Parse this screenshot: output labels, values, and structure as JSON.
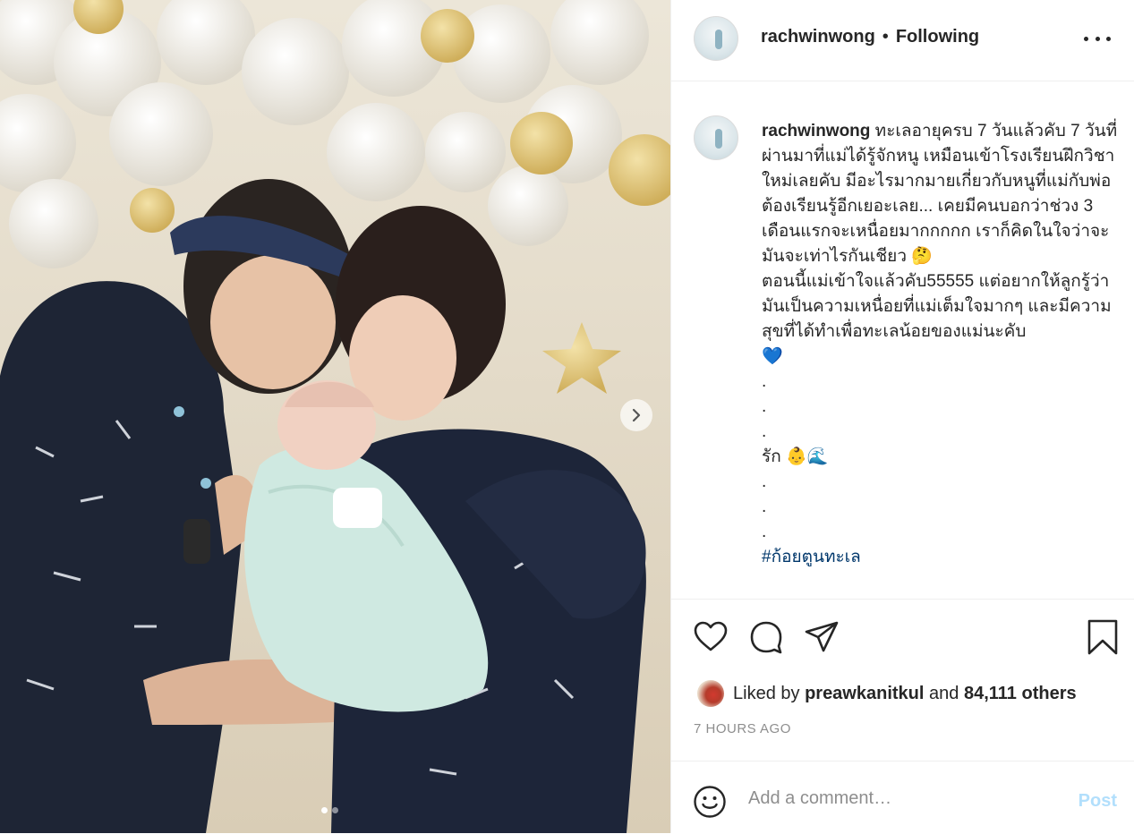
{
  "post": {
    "username": "rachwinwong",
    "separator": "•",
    "follow_status": "Following",
    "more_icon": "more-horizontal-icon"
  },
  "caption": {
    "username": "rachwinwong",
    "text": " ทะเลอายุครบ 7 วันแล้วคับ 7 วันที่ผ่านมาที่แม่ได้รู้จักหนู เหมือนเข้าโรงเรียนฝึกวิชาใหม่เลยคับ มีอะไรมากมายเกี่ยวกับหนูที่แม่กับพ่อต้องเรียนรู้อีกเยอะเลย... เคยมีคนบอกว่าช่วง 3 เดือนแรกจะเหนื่อยมากกกกก เราก็คิดในใจว่าจะมันจะเท่าไรกันเชียว 🤔\nตอนนี้แม่เข้าใจแล้วคับ55555 แต่อยากให้ลูกรู้ว่ามันเป็นความเหนื่อยที่แม่เต็มใจมากๆ และมีความสุขที่ได้ทำเพื่อทะเลน้อยของแม่นะคับ\n💙\n.\n.\n.\nรัก 👶🌊\n.\n.\n.\n",
    "hashtag": "#ก้อยตูนทะเล"
  },
  "actions": {
    "like_icon": "heart-icon",
    "comment_icon": "comment-icon",
    "share_icon": "share-icon",
    "save_icon": "bookmark-icon"
  },
  "likes": {
    "prefix": "Liked by",
    "liker": "preawkanitkul",
    "connector": "and",
    "others": "84,111 others"
  },
  "timestamp": "7 HOURS AGO",
  "comment_box": {
    "emoji_icon": "smiley-icon",
    "placeholder": "Add a comment…",
    "post_label": "Post",
    "post_color": "#b2dffc"
  },
  "carousel": {
    "next_icon": "chevron-right-icon",
    "slide_count": 2,
    "active_slide": 1
  }
}
